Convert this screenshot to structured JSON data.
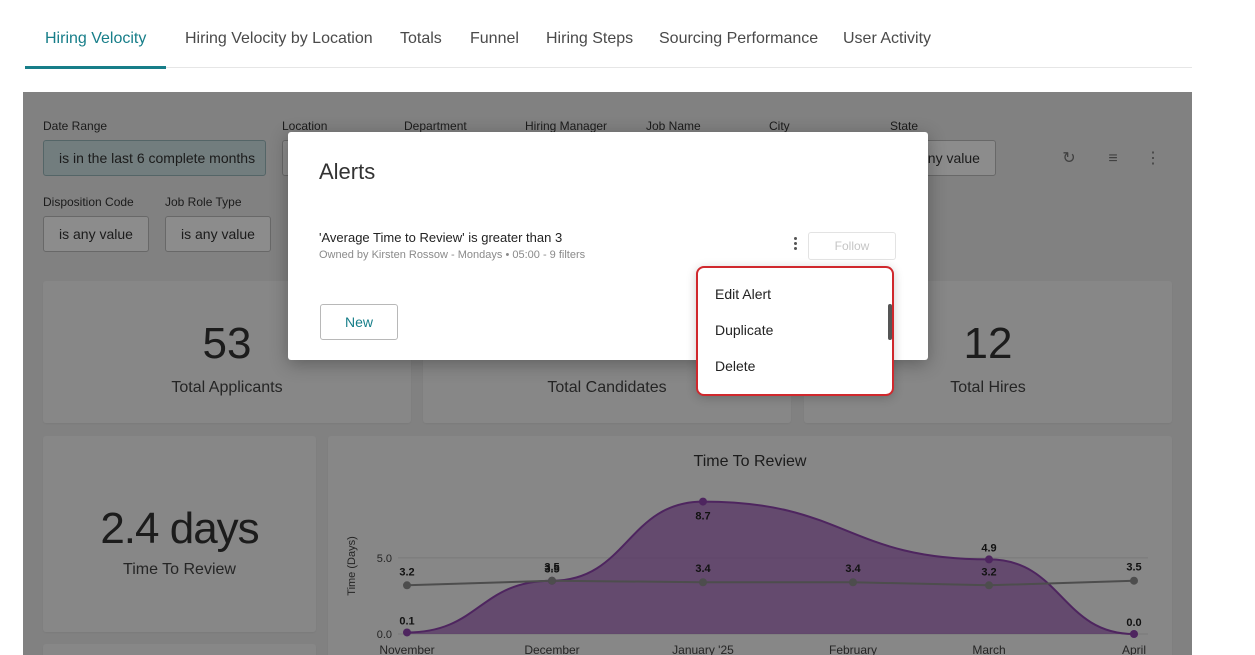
{
  "tabs": [
    {
      "label": "Hiring Velocity",
      "active": true
    },
    {
      "label": "Hiring Velocity by Location"
    },
    {
      "label": "Totals"
    },
    {
      "label": "Funnel"
    },
    {
      "label": "Hiring Steps"
    },
    {
      "label": "Sourcing Performance"
    },
    {
      "label": "User Activity"
    }
  ],
  "filters": {
    "date_range": {
      "label": "Date Range",
      "value": "is in the last 6 complete months"
    },
    "location": {
      "label": "Location"
    },
    "department": {
      "label": "Department"
    },
    "hiring_manager": {
      "label": "Hiring Manager"
    },
    "job_name": {
      "label": "Job Name"
    },
    "city": {
      "label": "City"
    },
    "state": {
      "label": "State",
      "value": "is any value"
    },
    "disposition_code": {
      "label": "Disposition Code",
      "value": "is any value"
    },
    "job_role_type": {
      "label": "Job Role Type",
      "value": "is any value"
    }
  },
  "toolbar_icons": [
    "refresh-icon",
    "filter-icon",
    "more-vertical-icon"
  ],
  "tiles": {
    "applicants": {
      "value": "53",
      "label": "Total Applicants"
    },
    "candidates": {
      "label": "Total Candidates"
    },
    "hires": {
      "value": "12",
      "label": "Total Hires"
    },
    "review": {
      "value": "2.4 days",
      "label": "Time To Review"
    }
  },
  "chart_data": {
    "type": "area",
    "title": "Time To Review",
    "ylabel": "Time (Days)",
    "yticks": [
      "0.0",
      "5.0"
    ],
    "ylim": [
      0,
      9
    ],
    "categories": [
      "November",
      "December",
      "January '25",
      "February",
      "March",
      "April"
    ],
    "series": [
      {
        "values": [
          0.1,
          3.5,
          8.7,
          null,
          4.9,
          0.0
        ],
        "color": "#9b59b6",
        "kind": "area"
      },
      {
        "values": [
          3.2,
          3.5,
          3.4,
          3.4,
          3.2,
          3.5
        ],
        "color": "#8c8c8c",
        "kind": "line"
      }
    ]
  },
  "modal": {
    "title": "Alerts",
    "alert": {
      "name": "'Average Time to Review' is greater than 3",
      "meta": "Owned by Kirsten Rossow - Mondays • 05:00 - 9 filters",
      "follow_label": "Follow"
    },
    "new_label": "New"
  },
  "menu": {
    "items": [
      "Edit Alert",
      "Duplicate",
      "Delete"
    ]
  },
  "colors": {
    "accent": "#177e89",
    "highlight": "#d0282d",
    "purple": "#9b59b6"
  }
}
